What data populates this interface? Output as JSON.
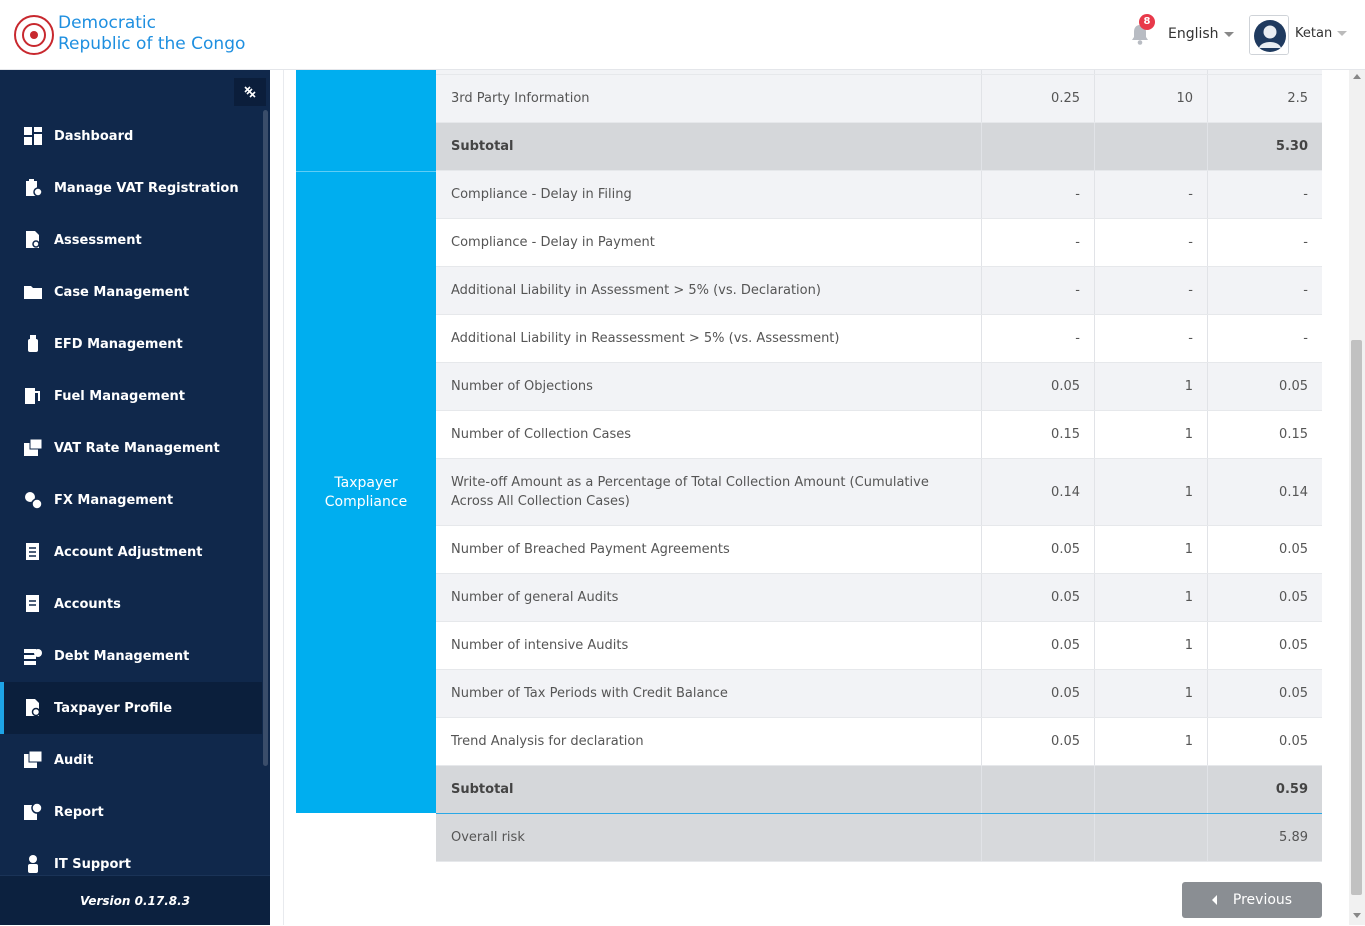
{
  "header": {
    "brand_line1": "Democratic",
    "brand_line2": "Republic of the Congo",
    "notification_count": "8",
    "language": "English",
    "user_name": "Ketan"
  },
  "sidebar": {
    "items": [
      {
        "label": "Dashboard",
        "icon": "dashboard-icon"
      },
      {
        "label": "Manage VAT Registration",
        "icon": "registration-icon"
      },
      {
        "label": "Assessment",
        "icon": "assessment-icon"
      },
      {
        "label": "Case Management",
        "icon": "folder-icon"
      },
      {
        "label": "EFD Management",
        "icon": "device-icon"
      },
      {
        "label": "Fuel Management",
        "icon": "fuel-icon"
      },
      {
        "label": "VAT Rate Management",
        "icon": "rate-icon"
      },
      {
        "label": "FX Management",
        "icon": "fx-icon"
      },
      {
        "label": "Account Adjustment",
        "icon": "adjust-icon"
      },
      {
        "label": "Accounts",
        "icon": "accounts-icon"
      },
      {
        "label": "Debt Management",
        "icon": "debt-icon"
      },
      {
        "label": "Taxpayer Profile",
        "icon": "profile-icon"
      },
      {
        "label": "Audit",
        "icon": "audit-icon"
      },
      {
        "label": "Report",
        "icon": "report-icon"
      },
      {
        "label": "IT Support",
        "icon": "support-icon"
      }
    ],
    "active_item": "Taxpayer Profile",
    "version": "Version 0.17.8.3"
  },
  "table": {
    "category_compliance": "Taxpayer Compliance",
    "top_rows": [
      {
        "name": "3rd Party Information",
        "weight": "0.25",
        "score": "10",
        "result": "2.5"
      }
    ],
    "top_subtotal": {
      "label": "Subtotal",
      "value": "5.30"
    },
    "compliance_rows": [
      {
        "name": "Compliance - Delay in Filing",
        "weight": "-",
        "score": "-",
        "result": "-"
      },
      {
        "name": "Compliance - Delay in Payment",
        "weight": "-",
        "score": "-",
        "result": "-"
      },
      {
        "name": "Additional Liability in Assessment > 5% (vs. Declaration)",
        "weight": "-",
        "score": "-",
        "result": "-"
      },
      {
        "name": "Additional Liability in Reassessment > 5% (vs. Assessment)",
        "weight": "-",
        "score": "-",
        "result": "-"
      },
      {
        "name": "Number of Objections",
        "weight": "0.05",
        "score": "1",
        "result": "0.05"
      },
      {
        "name": "Number of Collection Cases",
        "weight": "0.15",
        "score": "1",
        "result": "0.15"
      },
      {
        "name": "Write-off Amount as a Percentage of Total Collection Amount (Cumulative Across All Collection Cases)",
        "weight": "0.14",
        "score": "1",
        "result": "0.14"
      },
      {
        "name": "Number of Breached Payment Agreements",
        "weight": "0.05",
        "score": "1",
        "result": "0.05"
      },
      {
        "name": "Number of general Audits",
        "weight": "0.05",
        "score": "1",
        "result": "0.05"
      },
      {
        "name": "Number of intensive Audits",
        "weight": "0.05",
        "score": "1",
        "result": "0.05"
      },
      {
        "name": "Number of Tax Periods with Credit Balance",
        "weight": "0.05",
        "score": "1",
        "result": "0.05"
      },
      {
        "name": "Trend Analysis for declaration",
        "weight": "0.05",
        "score": "1",
        "result": "0.05"
      }
    ],
    "compliance_subtotal": {
      "label": "Subtotal",
      "value": "0.59"
    },
    "overall": {
      "label": "Overall risk",
      "value": "5.89"
    }
  },
  "footer": {
    "previous_label": "Previous"
  },
  "colors": {
    "sidebar_bg": "#10284b",
    "category_blue": "#00aeef",
    "brand_blue": "#1e8fe0",
    "badge_red": "#e8394a"
  }
}
